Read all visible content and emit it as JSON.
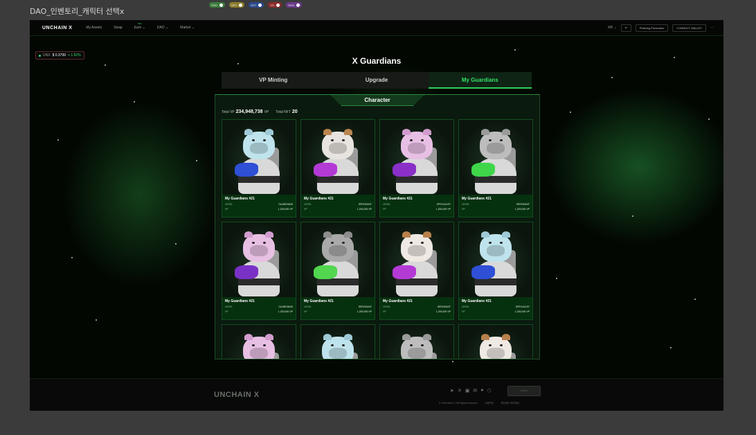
{
  "frame_title": "DAO_인벤토리_캐릭터 선택x",
  "legend": [
    {
      "label": "GRD",
      "color": "#3a7a3a"
    },
    {
      "label": "SPC",
      "color": "#8a7a2a"
    },
    {
      "label": "SGT",
      "color": "#2a4a8a"
    },
    {
      "label": "CD",
      "color": "#8a2a2a"
    },
    {
      "label": "GEN",
      "color": "#6a3a8a"
    }
  ],
  "nav": {
    "logo": "UNCHAIN X",
    "menu": [
      "My Assets",
      "Swap",
      "Earn",
      "DAO",
      "Market"
    ],
    "earn_badge": "New",
    "lang": "KR",
    "phishing": "Phishing Prevention",
    "connect": "CONNECT WALLET",
    "more": "···"
  },
  "price": {
    "symbol": "UNX",
    "value": "$ 0.3799",
    "change": "+ 1.92%"
  },
  "page_title": "X Guardians",
  "tabs": [
    {
      "label": "VP Minting",
      "active": false
    },
    {
      "label": "Upgrade",
      "active": false
    },
    {
      "label": "My Guardians",
      "active": true
    }
  ],
  "panel": {
    "header": "Character",
    "total_vp_label": "Total VP",
    "total_vp_value": "234,948,738",
    "total_vp_unit": "VP",
    "total_nft_label": "Total NFT",
    "total_nft_value": "20"
  },
  "cards": [
    {
      "name": "My Guardians #21",
      "level_label": "LEVEL",
      "level": "GUARDIANS",
      "vp_label": "VP",
      "vp": "1,200,000 VP",
      "fur": "#bfe3ec",
      "ear": "#9fc9d6",
      "gun": "#2e4fd6"
    },
    {
      "name": "My Guardians #21",
      "level_label": "LEVEL",
      "level": "SERGEANT",
      "vp_label": "VP",
      "vp": "1,200,000 VP",
      "fur": "#e7e3df",
      "ear": "#b9854f",
      "gun": "#b43ad6"
    },
    {
      "name": "My Guardians #21",
      "level_label": "LEVEL",
      "level": "SPECIALIST",
      "vp_label": "VP",
      "vp": "1,200,000 VP",
      "fur": "#e8bfe4",
      "ear": "#d19ccd",
      "gun": "#8a2fc8"
    },
    {
      "name": "My Guardians #21",
      "level_label": "LEVEL",
      "level": "SERGEANT",
      "vp_label": "VP",
      "vp": "1,200,000 VP",
      "fur": "#bdbdbd",
      "ear": "#9a9a9a",
      "gun": "#3fd64a"
    },
    {
      "name": "My Guardians #21",
      "level_label": "LEVEL",
      "level": "GUARDIANS",
      "vp_label": "VP",
      "vp": "1,200,000 VP",
      "fur": "#e7bfe3",
      "ear": "#d29ccf",
      "gun": "#7a32c6"
    },
    {
      "name": "My Guardians #21",
      "level_label": "LEVEL",
      "level": "SERGEANT",
      "vp_label": "VP",
      "vp": "1,200,000 VP",
      "fur": "#a9aaa9",
      "ear": "#8c8c8c",
      "gun": "#52d64f"
    },
    {
      "name": "My Guardians #21",
      "level_label": "LEVEL",
      "level": "SERGEANT",
      "vp_label": "VP",
      "vp": "1,200,000 VP",
      "fur": "#efe9e3",
      "ear": "#b8814d",
      "gun": "#b43ad6"
    },
    {
      "name": "My Guardians #21",
      "level_label": "LEVEL",
      "level": "SPECIALIST",
      "vp_label": "VP",
      "vp": "1,200,000 VP",
      "fur": "#bfe3ec",
      "ear": "#9fc9d6",
      "gun": "#2e4fd6"
    },
    {
      "name": "",
      "level_label": "",
      "level": "",
      "vp_label": "",
      "vp": "",
      "fur": "#e7bfe3",
      "ear": "#d29ccf",
      "gun": "#7a32c6"
    },
    {
      "name": "",
      "level_label": "",
      "level": "",
      "vp_label": "",
      "vp": "",
      "fur": "#bfe3ec",
      "ear": "#9fc9d6",
      "gun": "#2e4fd6"
    },
    {
      "name": "",
      "level_label": "",
      "level": "",
      "vp_label": "",
      "vp": "",
      "fur": "#bdbdbd",
      "ear": "#9a9a9a",
      "gun": "#3fd64a"
    },
    {
      "name": "",
      "level_label": "",
      "level": "",
      "vp_label": "",
      "vp": "",
      "fur": "#efe9e3",
      "ear": "#b8814d",
      "gun": "#b43ad6"
    }
  ],
  "footer": {
    "logo": "UNCHAIN X",
    "social_icons": [
      "telegram-icon",
      "x-icon",
      "medium-icon",
      "mail-icon",
      "github-icon",
      "gitbook-icon"
    ],
    "security_badge": "CERTIK",
    "copyright": "© UNCHAIN X. All Rights Reserved.",
    "terms": "이용약관",
    "privacy": "개인정보 처리방침"
  }
}
